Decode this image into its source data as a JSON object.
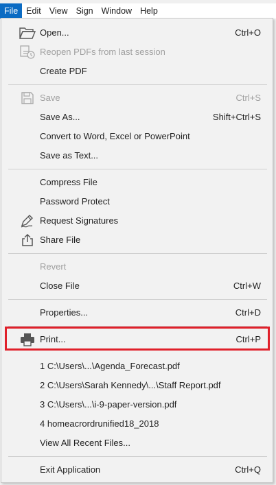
{
  "menubar": {
    "items": [
      "File",
      "Edit",
      "View",
      "Sign",
      "Window",
      "Help"
    ]
  },
  "file_menu": {
    "open": {
      "label": "Open...",
      "shortcut": "Ctrl+O",
      "icon": "folder-open-icon"
    },
    "reopen": {
      "label": "Reopen PDFs from last session",
      "icon": "reopen-pdf-icon"
    },
    "create_pdf": {
      "label": "Create PDF"
    },
    "save": {
      "label": "Save",
      "shortcut": "Ctrl+S",
      "icon": "floppy-disk-icon"
    },
    "save_as": {
      "label": "Save As...",
      "shortcut": "Shift+Ctrl+S"
    },
    "convert": {
      "label": "Convert to Word, Excel or PowerPoint"
    },
    "save_as_text": {
      "label": "Save as Text..."
    },
    "compress": {
      "label": "Compress File"
    },
    "password": {
      "label": "Password Protect"
    },
    "request_signatures": {
      "label": "Request Signatures",
      "icon": "pen-sign-icon"
    },
    "share": {
      "label": "Share File",
      "icon": "share-icon"
    },
    "revert": {
      "label": "Revert"
    },
    "close": {
      "label": "Close File",
      "shortcut": "Ctrl+W"
    },
    "properties": {
      "label": "Properties...",
      "shortcut": "Ctrl+D"
    },
    "print": {
      "label": "Print...",
      "shortcut": "Ctrl+P",
      "icon": "printer-icon"
    },
    "recent": [
      {
        "label": "1 C:\\Users\\...\\Agenda_Forecast.pdf"
      },
      {
        "label": "2 C:\\Users\\Sarah Kennedy\\...\\Staff Report.pdf"
      },
      {
        "label": "3 C:\\Users\\...\\i-9-paper-version.pdf"
      },
      {
        "label": "4 homeacrordrunified18_2018"
      }
    ],
    "view_all_recent": {
      "label": "View All Recent Files..."
    },
    "exit": {
      "label": "Exit Application",
      "shortcut": "Ctrl+Q"
    }
  },
  "colors": {
    "menu_active": "#0b6bc3",
    "highlight_border": "#e0202a",
    "disabled_text": "#a0a0a0"
  }
}
